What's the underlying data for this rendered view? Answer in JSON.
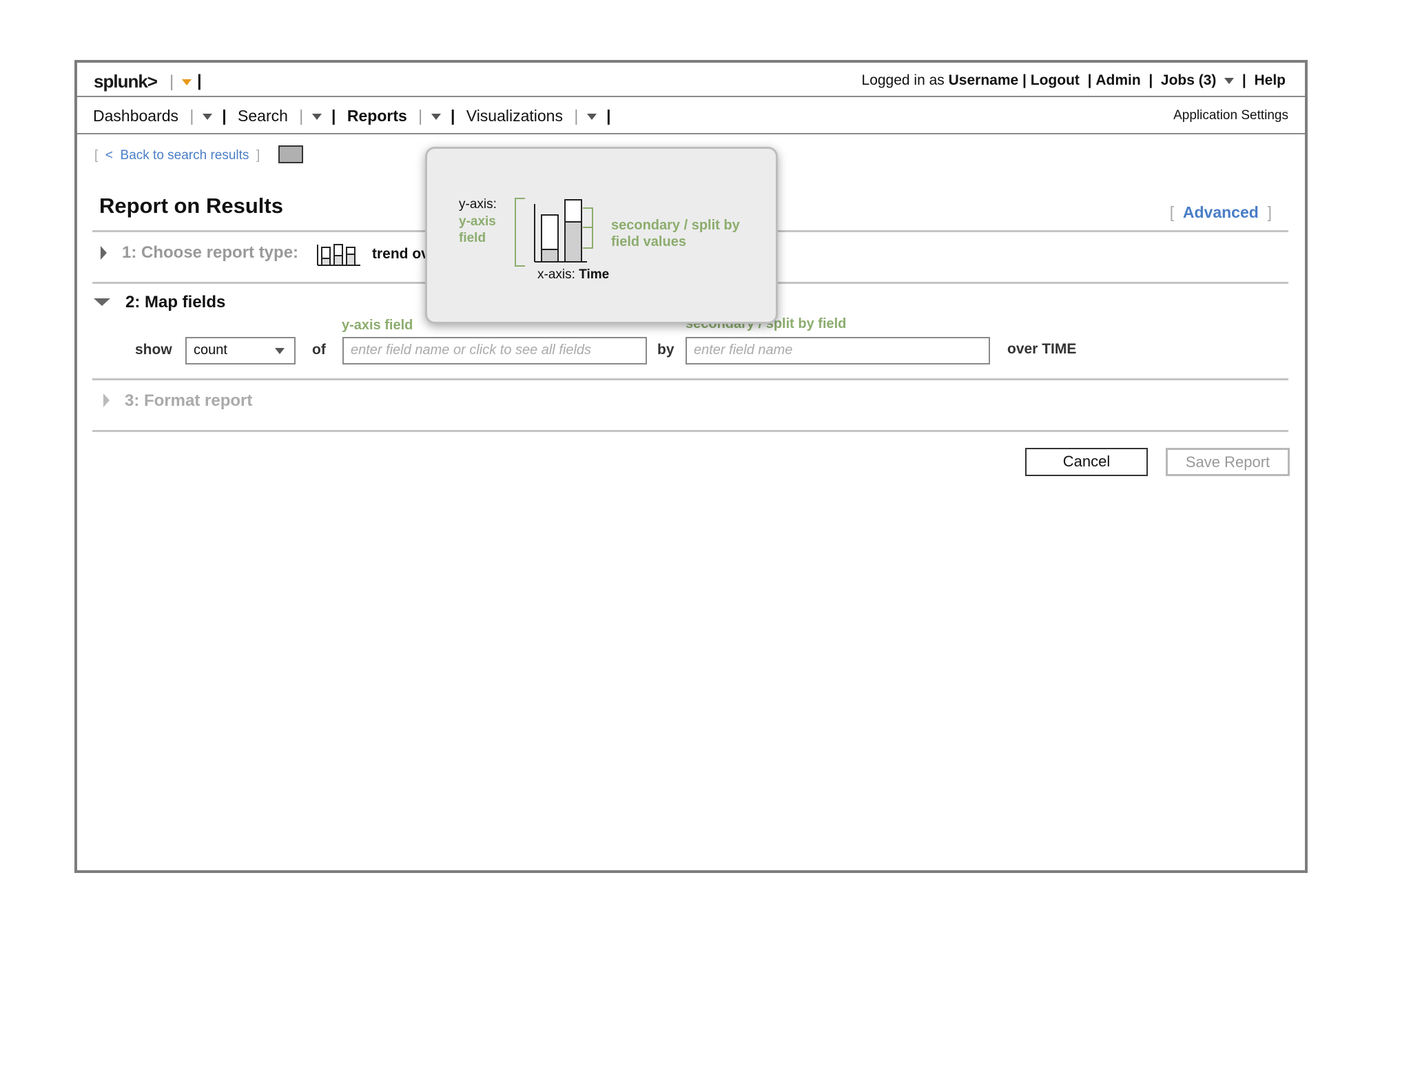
{
  "header": {
    "logo_text": "splunk",
    "logo_suffix": ">",
    "logged_in_prefix": "Logged in as",
    "username": "Username",
    "logout": "Logout",
    "admin": "Admin",
    "jobs": "Jobs (3)",
    "help": "Help"
  },
  "nav": {
    "items": [
      "Dashboards",
      "Search",
      "Reports",
      "Visualizations"
    ],
    "app_settings": "Application Settings"
  },
  "page": {
    "back_link": "Back to search results",
    "back_arrow": "<",
    "title": "Report on Results",
    "advanced": "Advanced"
  },
  "steps": {
    "step1_label": "1: Choose report type:",
    "step1_value": "trend ov",
    "step2_label": "2: Map fields",
    "step3_label": "3: Format report"
  },
  "map_fields": {
    "show_label": "show",
    "show_value": "count",
    "of_label": "of",
    "yaxis_caption": "y-axis field",
    "yaxis_placeholder": "enter field name or click to see all fields",
    "by_label": "by",
    "split_caption": "secondary / split by field",
    "split_placeholder": "enter field name",
    "over_label": "over TIME"
  },
  "popup": {
    "y_axis_label": "y-axis:",
    "y_axis_field_line1": "y-axis",
    "y_axis_field_line2": "field",
    "secondary_line1": "secondary / split by",
    "secondary_line2": "field values",
    "x_axis_prefix": "x-axis:",
    "x_axis_value": "Time"
  },
  "buttons": {
    "cancel": "Cancel",
    "save": "Save Report"
  },
  "colors": {
    "accent_green": "#8cad6e",
    "link_blue": "#4a7ec6",
    "frame_gray": "#7d7d7d",
    "logo_dropdown": "#e8991a"
  }
}
